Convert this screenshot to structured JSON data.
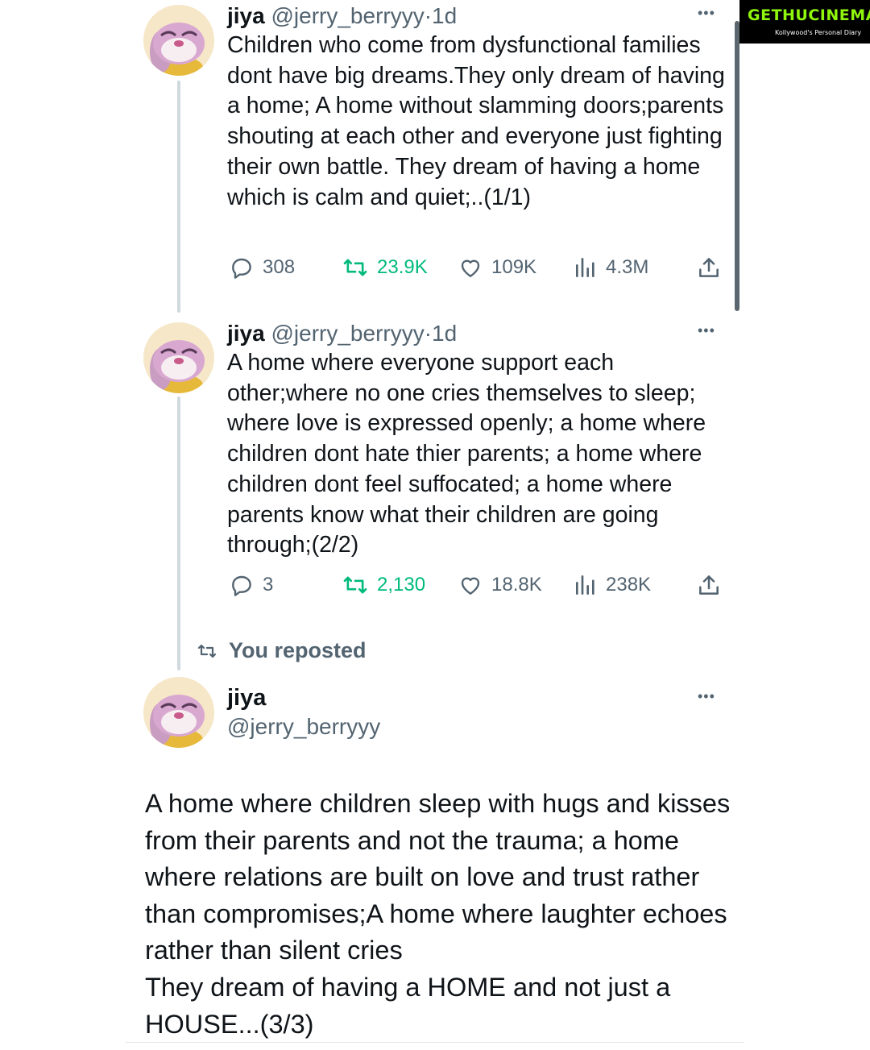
{
  "watermark": {
    "brand": "GETHUCINEMA",
    "tagline": "Kollywood's Personal Diary"
  },
  "tweets": [
    {
      "name": "jiya",
      "handle": "@jerry_berryyy",
      "time": "1d",
      "text": "Children who come from dysfunctional families dont have big dreams.They only dream of having a home; A home without slamming doors;parents shouting at each other and everyone just fighting their own battle. They dream of having a home which is calm and quiet;..(1/1)",
      "replies": "308",
      "reposts": "23.9K",
      "likes": "109K",
      "views": "4.3M"
    },
    {
      "name": "jiya",
      "handle": "@jerry_berryyy",
      "time": "1d",
      "text": "A home where everyone support each other;where no one cries themselves to sleep; where love is expressed openly; a home where children dont hate thier parents; a home where children dont feel suffocated; a home where parents know what their children are going through;(2/2)",
      "replies": "3",
      "reposts": "2,130",
      "likes": "18.8K",
      "views": "238K"
    }
  ],
  "repost_label": "You reposted",
  "main_tweet": {
    "name": "jiya",
    "handle": "@jerry_berryyy",
    "text": "A home where children sleep with hugs and kisses from their parents and not the trauma; a home where relations are built on love and trust rather than compromises;A home where laughter echoes rather than silent cries\nThey dream of having a HOME and not just a HOUSE...(3/3)"
  },
  "colors": {
    "accent": "#1d9bf0",
    "repost_green": "#00ba7c",
    "muted": "#536471",
    "text": "#0f1419",
    "brand_green": "#8ef50b"
  },
  "icons": [
    "reply-icon",
    "repost-icon",
    "like-icon",
    "views-icon",
    "share-icon",
    "more-icon"
  ]
}
